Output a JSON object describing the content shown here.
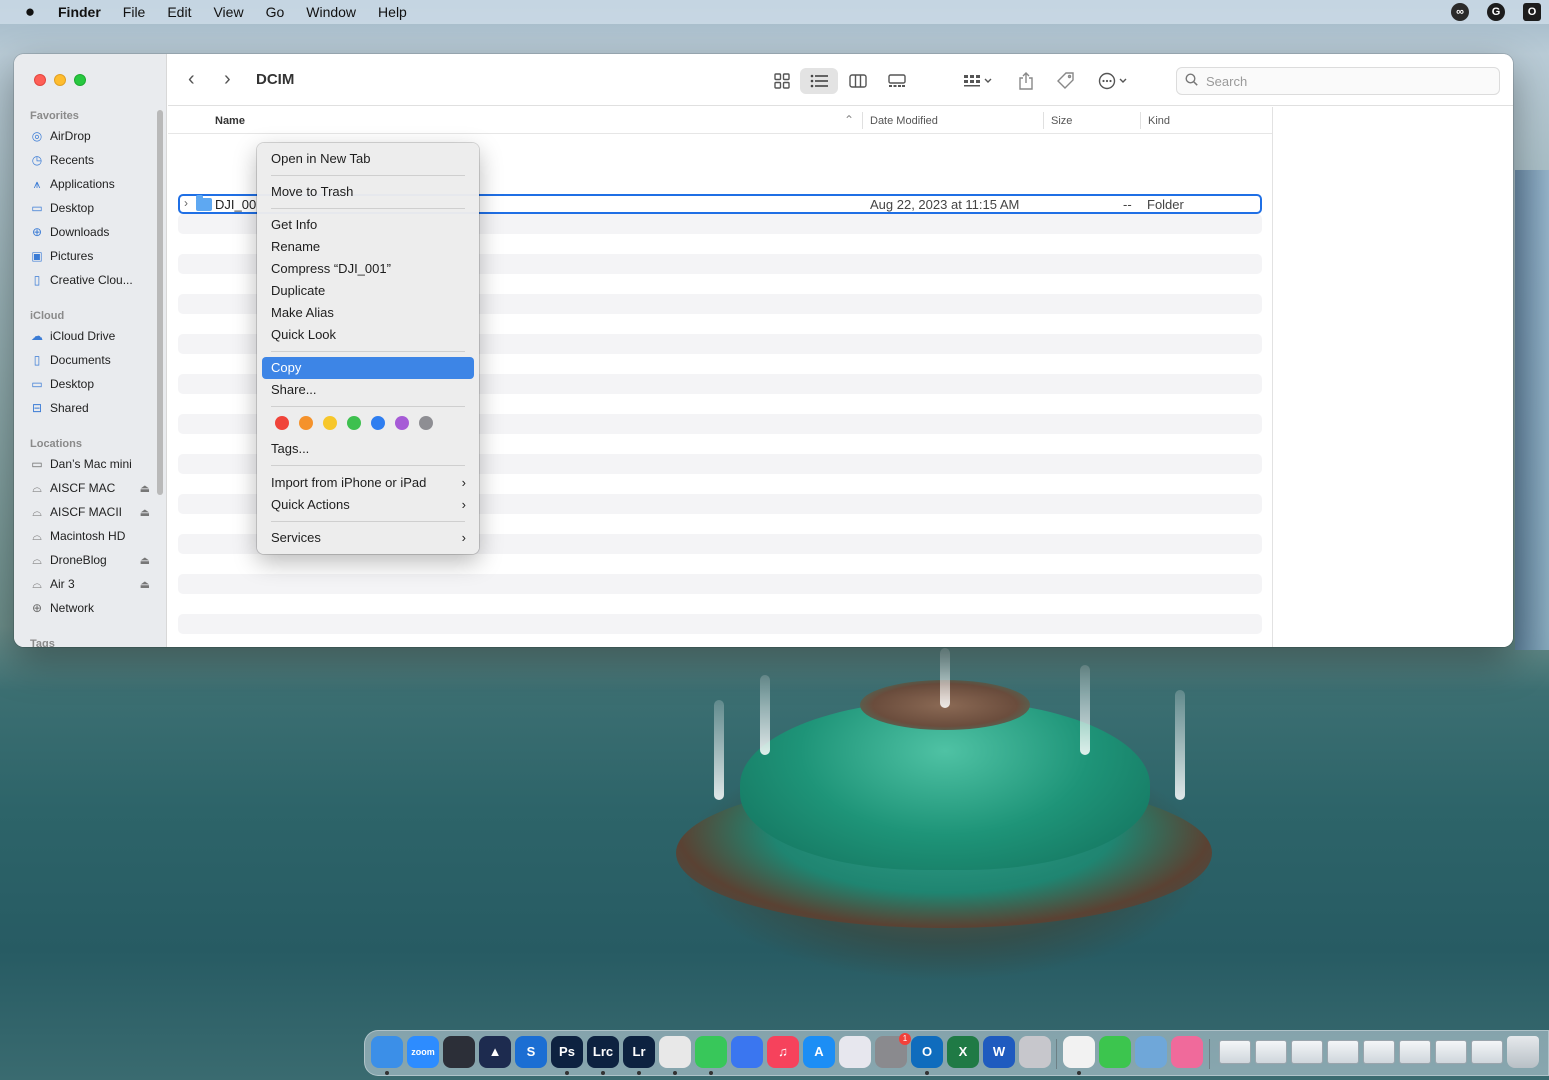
{
  "menubar": {
    "apple_icon": "apple-logo-icon",
    "app_name": "Finder",
    "items": [
      "File",
      "Edit",
      "View",
      "Go",
      "Window",
      "Help"
    ],
    "right_icons": [
      "creative-cloud-icon",
      "grammarly-icon",
      "outlook-icon"
    ]
  },
  "window": {
    "title": "DCIM",
    "search_placeholder": "Search",
    "toolbar_icons": [
      "icon-view-icon",
      "list-view-icon",
      "column-view-icon",
      "gallery-view-icon",
      "group-by-icon",
      "share-icon",
      "tag-icon",
      "more-actions-icon"
    ],
    "active_view": "list"
  },
  "sidebar": {
    "favorites_label": "Favorites",
    "favorites": [
      {
        "label": "AirDrop",
        "icon": "airdrop-icon"
      },
      {
        "label": "Recents",
        "icon": "clock-icon"
      },
      {
        "label": "Applications",
        "icon": "applications-icon"
      },
      {
        "label": "Desktop",
        "icon": "desktop-icon"
      },
      {
        "label": "Downloads",
        "icon": "download-icon"
      },
      {
        "label": "Pictures",
        "icon": "pictures-icon"
      },
      {
        "label": "Creative Clou...",
        "icon": "document-icon"
      }
    ],
    "icloud_label": "iCloud",
    "icloud": [
      {
        "label": "iCloud Drive",
        "icon": "cloud-icon"
      },
      {
        "label": "Documents",
        "icon": "document-icon"
      },
      {
        "label": "Desktop",
        "icon": "desktop-icon"
      },
      {
        "label": "Shared",
        "icon": "shared-folder-icon"
      }
    ],
    "locations_label": "Locations",
    "locations": [
      {
        "label": "Dan’s Mac mini",
        "icon": "computer-icon",
        "eject": false
      },
      {
        "label": "AISCF MAC",
        "icon": "drive-icon",
        "eject": true
      },
      {
        "label": "AISCF MACII",
        "icon": "drive-icon",
        "eject": true
      },
      {
        "label": "Macintosh HD",
        "icon": "drive-icon",
        "eject": false
      },
      {
        "label": "DroneBlog",
        "icon": "drive-icon",
        "eject": true
      },
      {
        "label": "Air 3",
        "icon": "drive-icon",
        "eject": true
      },
      {
        "label": "Network",
        "icon": "globe-icon",
        "eject": false
      }
    ],
    "tags_label": "Tags"
  },
  "columns": {
    "name": "Name",
    "date_modified": "Date Modified",
    "size": "Size",
    "kind": "Kind"
  },
  "files": [
    {
      "name": "DJI_00",
      "date_modified": "Aug 22, 2023 at 11:15 AM",
      "size": "--",
      "kind": "Folder"
    }
  ],
  "context_menu": {
    "items": {
      "open_new_tab": "Open in New Tab",
      "move_to_trash": "Move to Trash",
      "get_info": "Get Info",
      "rename": "Rename",
      "compress": "Compress “DJI_001”",
      "duplicate": "Duplicate",
      "make_alias": "Make Alias",
      "quick_look": "Quick Look",
      "copy": "Copy",
      "share": "Share...",
      "tags": "Tags...",
      "import_iphone": "Import from iPhone or iPad",
      "quick_actions": "Quick Actions",
      "services": "Services"
    },
    "highlighted": "Copy",
    "tag_colors": [
      "#f0443a",
      "#f5922b",
      "#f7c72b",
      "#3ec04f",
      "#2f7ef0",
      "#a65bd6",
      "#8e8e93"
    ]
  },
  "dock": {
    "apps": [
      {
        "name": "finder-icon",
        "label": "",
        "color": "#3b8fe8"
      },
      {
        "name": "zoom-icon",
        "label": "zoom",
        "color": "#2d8cff"
      },
      {
        "name": "davinci-resolve-icon",
        "label": "",
        "color": "#2c2f38"
      },
      {
        "name": "affinity-icon",
        "label": "▲",
        "color": "#1d2b4f"
      },
      {
        "name": "skitch-icon",
        "label": "S",
        "color": "#1b6ed3"
      },
      {
        "name": "photoshop-icon",
        "label": "Ps",
        "color": "#0d2240"
      },
      {
        "name": "lightroom-classic-icon",
        "label": "Lrc",
        "color": "#0d2240"
      },
      {
        "name": "lightroom-icon",
        "label": "Lr",
        "color": "#0d2240"
      },
      {
        "name": "chrome-icon",
        "label": "",
        "color": "#e8e8e8"
      },
      {
        "name": "messages-icon",
        "label": "",
        "color": "#38c75a"
      },
      {
        "name": "signal-icon",
        "label": "",
        "color": "#3a76f0"
      },
      {
        "name": "music-icon",
        "label": "♫",
        "color": "#f6425c"
      },
      {
        "name": "app-store-icon",
        "label": "A",
        "color": "#1c8ef5"
      },
      {
        "name": "launchpad-icon",
        "label": "",
        "color": "#e7e7ee"
      },
      {
        "name": "system-settings-icon",
        "label": "",
        "color": "#8a8a8e"
      },
      {
        "name": "outlook-icon",
        "label": "O",
        "color": "#0f6cbd"
      },
      {
        "name": "excel-icon",
        "label": "X",
        "color": "#1f7a45"
      },
      {
        "name": "word-icon",
        "label": "W",
        "color": "#1f5bbf"
      },
      {
        "name": "dvd-player-icon",
        "label": "",
        "color": "#c7c7cc"
      },
      {
        "name": "microsoft-store-icon",
        "label": "",
        "color": "#f2f2f2"
      },
      {
        "name": "facetime-icon",
        "label": "",
        "color": "#3cc54e"
      },
      {
        "name": "preview-icon",
        "label": "",
        "color": "#6fa7d9"
      },
      {
        "name": "cleanmymac-icon",
        "label": "",
        "color": "#f06a9b"
      }
    ],
    "settings_badge": "1"
  }
}
